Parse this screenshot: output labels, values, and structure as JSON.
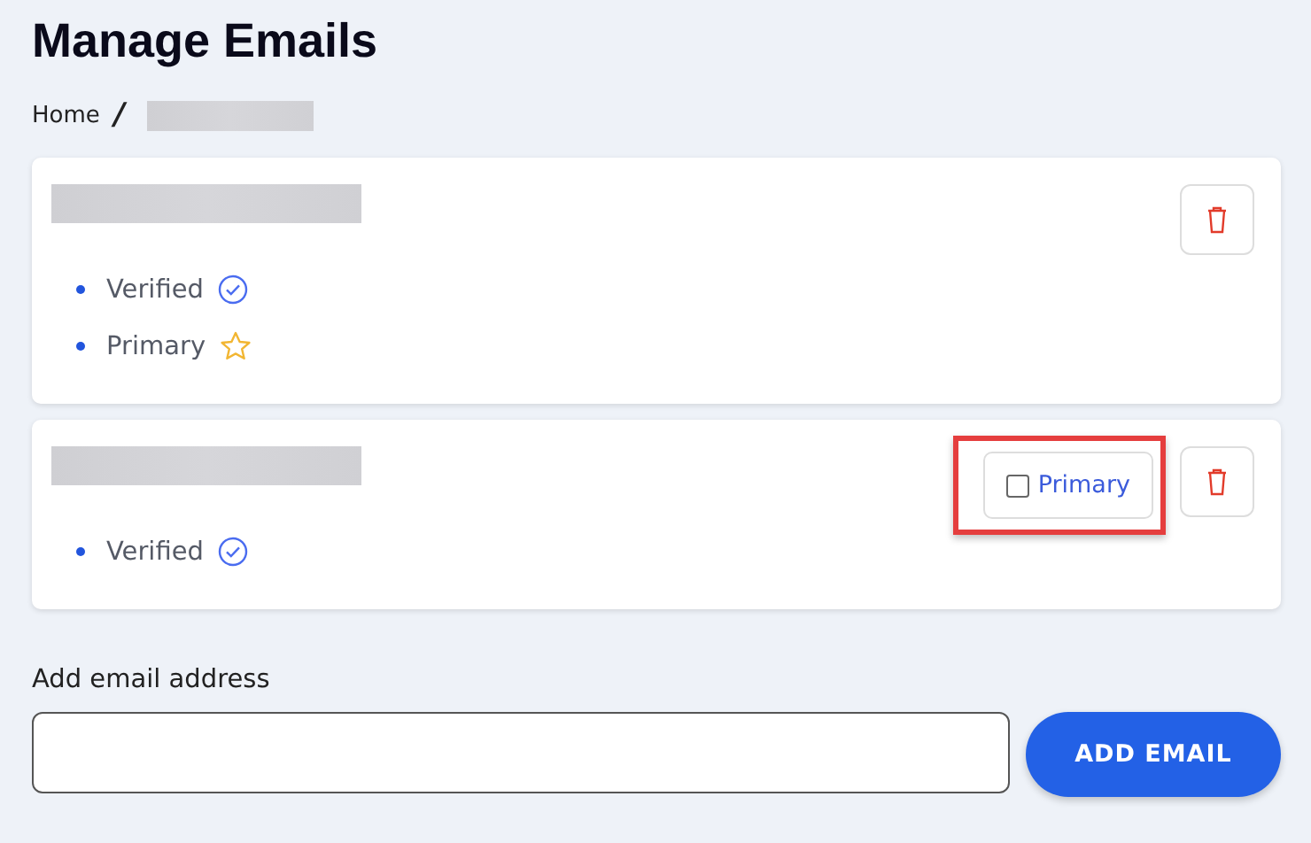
{
  "title": "Manage Emails",
  "breadcrumb": [
    {
      "label": "Home"
    },
    {
      "label": "/"
    }
  ],
  "emails": [
    {
      "statuses": [
        {
          "kind": "verified",
          "label": "Verified"
        },
        {
          "kind": "primary",
          "label": "Primary"
        }
      ]
    },
    {
      "statuses": [
        {
          "kind": "verified",
          "label": "Verified"
        }
      ],
      "make_primary": {
        "label": "Primary",
        "checked": false,
        "highlighted": true
      }
    }
  ],
  "add_email": {
    "label": "Add email address",
    "button": "ADD EMAIL"
  }
}
